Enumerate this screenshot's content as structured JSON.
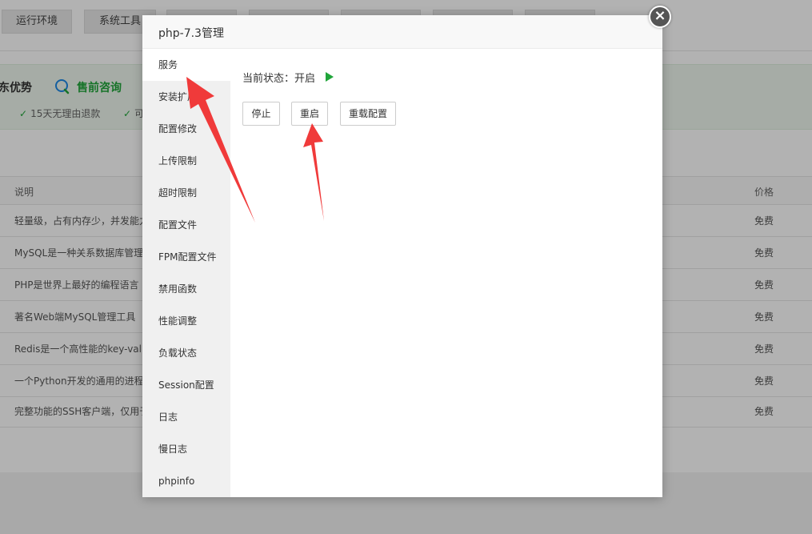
{
  "background": {
    "top_tabs": [
      "运行环境",
      "系统工具",
      "",
      "",
      "",
      "",
      ""
    ],
    "promo": {
      "title_partial": "东优势",
      "consult": "售前咨询",
      "items": [
        "15天无理由退款",
        "可"
      ]
    },
    "table": {
      "headers": {
        "desc": "说明",
        "price": "价格"
      },
      "rows": [
        {
          "desc": "轻量级，占有内存少，并发能力",
          "price": "免费"
        },
        {
          "desc": "MySQL是一种关系数据库管理",
          "price": "免费"
        },
        {
          "desc": "PHP是世界上最好的编程语言",
          "price": "免费"
        },
        {
          "desc": "著名Web端MySQL管理工具",
          "price": "免费"
        },
        {
          "desc": "Redis是一个高性能的key-valu",
          "price": "免费"
        },
        {
          "desc": "一个Python开发的通用的进程",
          "price": "免费"
        },
        {
          "desc": "完整功能的SSH客户端，仅用于",
          "price": "免费"
        }
      ]
    }
  },
  "modal": {
    "title": "php-7.3管理",
    "close_icon": "close-icon",
    "menu": [
      "服务",
      "安装扩展",
      "配置修改",
      "上传限制",
      "超时限制",
      "配置文件",
      "FPM配置文件",
      "禁用函数",
      "性能调整",
      "负载状态",
      "Session配置",
      "日志",
      "慢日志",
      "phpinfo"
    ],
    "active_menu": "服务",
    "status_label": "当前状态：开启",
    "status_color": "#20a53a",
    "buttons": {
      "stop": "停止",
      "restart": "重启",
      "reload": "重载配置"
    }
  },
  "annotation_color": "#f03a3a"
}
